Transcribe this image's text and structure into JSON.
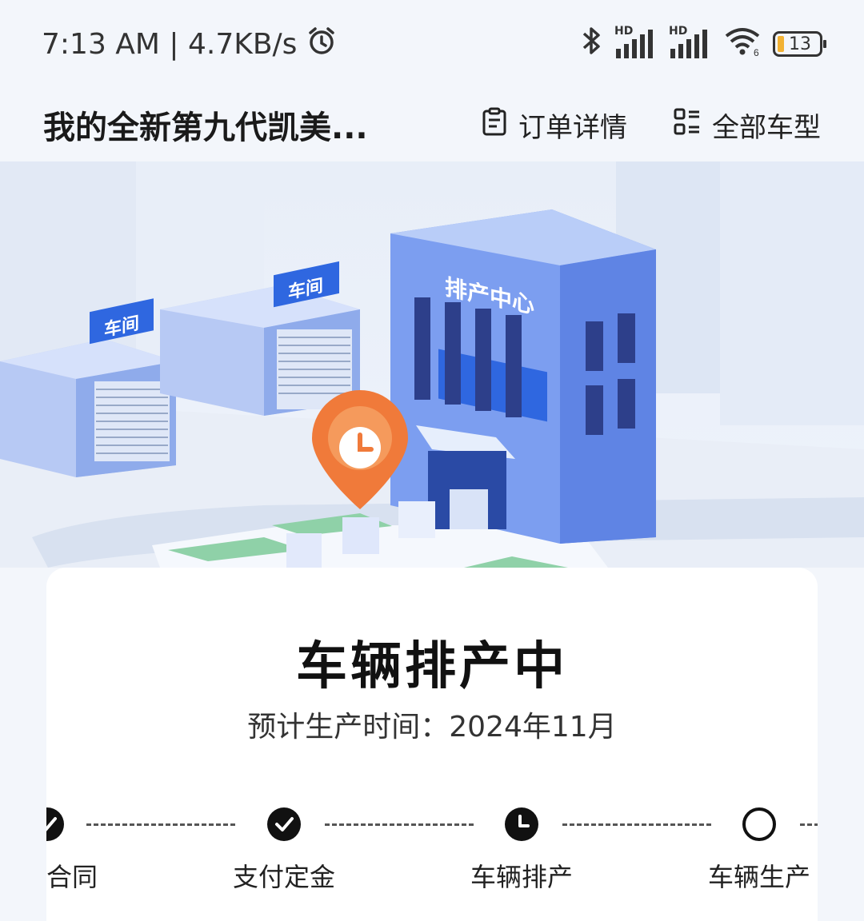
{
  "status_bar": {
    "time_speed": "7:13 AM | 4.7KB/s",
    "battery": "13",
    "icons": [
      "alarm-icon",
      "bluetooth-icon",
      "signal-hd-icon",
      "signal-hd-icon",
      "wifi-6-icon",
      "battery-icon"
    ],
    "hd_label": "HD"
  },
  "nav": {
    "title": "我的全新第九代凯美...",
    "order_detail_label": "订单详情",
    "all_models_label": "全部车型"
  },
  "hero": {
    "building_sign": "排产中心",
    "workshop_sign_1": "车间",
    "workshop_sign_2": "车间"
  },
  "card": {
    "status_title": "车辆排产中",
    "expected_time": "预计生产时间：2024年11月"
  },
  "steps": [
    {
      "label": "合同",
      "state": "done"
    },
    {
      "label": "支付定金",
      "state": "done"
    },
    {
      "label": "车辆排产",
      "state": "current"
    },
    {
      "label": "车辆生产",
      "state": "todo"
    }
  ],
  "colors": {
    "background": "#f3f6fb",
    "building_blue": "#6f93ee",
    "accent_orange": "#f07a3a",
    "sign_blue": "#2f67e0",
    "step_black": "#111111"
  }
}
